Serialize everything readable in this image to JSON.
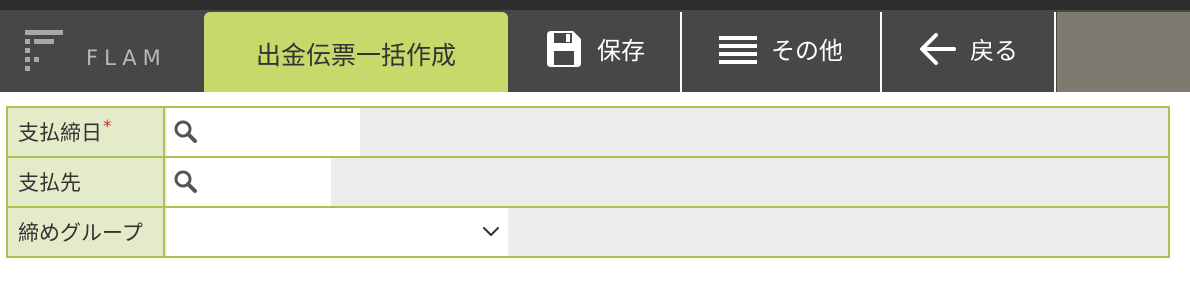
{
  "header": {
    "logo_text": "FLAM",
    "active_tab": "出金伝票一括作成",
    "buttons": {
      "save": "保存",
      "other": "その他",
      "back": "戻る"
    }
  },
  "form": {
    "rows": [
      {
        "label": "支払締日",
        "required_mark": "*",
        "value": "",
        "placeholder": ""
      },
      {
        "label": "支払先",
        "value": "",
        "placeholder": ""
      },
      {
        "label": "締めグループ",
        "selected": ""
      }
    ]
  },
  "colors": {
    "header_bg": "#474747",
    "active_tab": "#c8d96b",
    "label_bg": "#e3ebc9",
    "border": "#a9c34f",
    "required": "#d9272e"
  }
}
